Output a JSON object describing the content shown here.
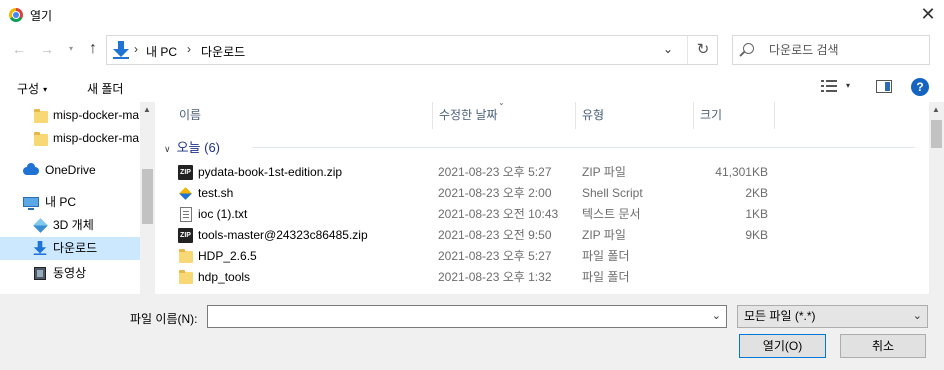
{
  "window": {
    "title": "열기",
    "close_glyph": "✕"
  },
  "nav": {
    "back": "←",
    "forward": "→",
    "recent": "▾",
    "up": "↑"
  },
  "address": {
    "crumbs": [
      "내 PC",
      "다운로드"
    ],
    "separator": "›",
    "dropdown": "⌄",
    "refresh": "↻"
  },
  "search": {
    "placeholder": "다운로드 검색"
  },
  "toolbar": {
    "organize": "구성",
    "caret": "▾",
    "new_folder": "새 폴더",
    "help": "?"
  },
  "sidebar": {
    "items": [
      {
        "label": "misp-docker-ma",
        "icon": "folder-icon"
      },
      {
        "label": "misp-docker-ma",
        "icon": "folder-icon"
      },
      {
        "label": "OneDrive",
        "icon": "cloud-icon"
      },
      {
        "label": "내 PC",
        "icon": "pc-icon"
      },
      {
        "label": "3D 개체",
        "icon": "cube-icon"
      },
      {
        "label": "다운로드",
        "icon": "download-icon",
        "selected": true
      },
      {
        "label": "동영상",
        "icon": "video-icon"
      }
    ]
  },
  "filelist": {
    "columns": [
      "이름",
      "수정한 날짜",
      "유형",
      "크기"
    ],
    "group": {
      "label": "오늘 (6)",
      "chevron": "∨"
    },
    "rows": [
      {
        "name": "pydata-book-1st-edition.zip",
        "date": "2021-08-23 오후 5:27",
        "type": "ZIP 파일",
        "size": "41,301KB",
        "icon": "zip"
      },
      {
        "name": "test.sh",
        "date": "2021-08-23 오후 2:00",
        "type": "Shell Script",
        "size": "2KB",
        "icon": "sh"
      },
      {
        "name": "ioc (1).txt",
        "date": "2021-08-23 오전 10:43",
        "type": "텍스트 문서",
        "size": "1KB",
        "icon": "txt"
      },
      {
        "name": "tools-master@24323c86485.zip",
        "date": "2021-08-23 오전 9:50",
        "type": "ZIP 파일",
        "size": "9KB",
        "icon": "zip"
      },
      {
        "name": "HDP_2.6.5",
        "date": "2021-08-23 오후 5:27",
        "type": "파일 폴더",
        "size": "",
        "icon": "folder"
      },
      {
        "name": "hdp_tools",
        "date": "2021-08-23 오후 1:32",
        "type": "파일 폴더",
        "size": "",
        "icon": "folder"
      }
    ]
  },
  "bottom": {
    "filename_label": "파일 이름(N):",
    "filename_value": "",
    "filetype": "모든 파일 (*.*)",
    "open_button": "열기(O)",
    "cancel_button": "취소"
  },
  "colors": {
    "selection": "#cce8ff",
    "group_header": "#1e3287",
    "column_header": "#4c607a",
    "accent": "#0078d7"
  }
}
